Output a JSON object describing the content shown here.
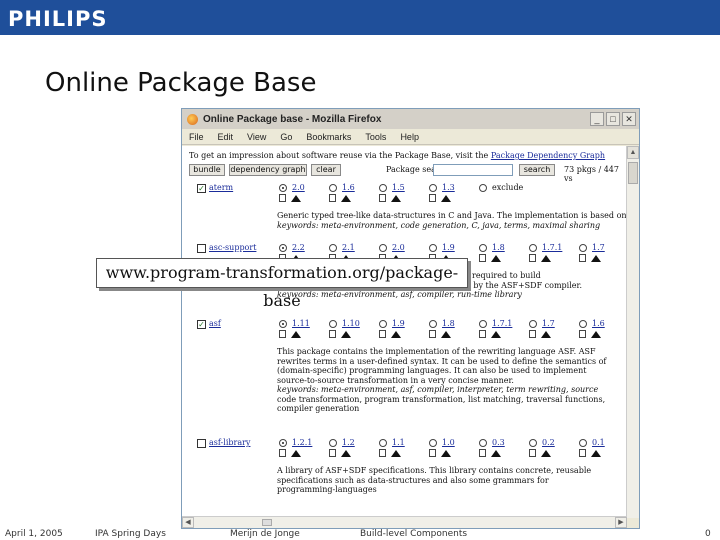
{
  "slide": {
    "logo": "PHILIPS",
    "title": "Online Package Base",
    "footer": {
      "date": "April 1, 2005",
      "event": "IPA Spring Days",
      "author": "Merijn de Jonge",
      "topic": "Build-level Components",
      "page": "0"
    },
    "callout": "www.program-transformation.org/package-base"
  },
  "colors": {
    "brand": "#1f4f9a",
    "link": "#1a2c9a"
  },
  "browser": {
    "title": "Online Package base - Mozilla Firefox",
    "window_buttons": [
      "_",
      "□",
      "✕"
    ],
    "menu": [
      "File",
      "Edit",
      "View",
      "Go",
      "Bookmarks",
      "Tools",
      "Help"
    ],
    "intro_text": "To get an impression about software reuse via the Package Base, visit the ",
    "intro_link": "Package Dependency Graph",
    "buttons": {
      "bundle": "bundle",
      "graph": "dependency graph",
      "clear": "clear",
      "search": "search"
    },
    "search_label": "Package search:",
    "page_info": "73 pkgs / 447 vs",
    "packages": [
      {
        "name": "aterm",
        "checked": true,
        "versions": [
          {
            "label": "2.0",
            "selected": true
          },
          {
            "label": "1.6",
            "selected": false
          },
          {
            "label": "1.5",
            "selected": false
          },
          {
            "label": "1.3",
            "selected": false
          }
        ],
        "exclude": "exclude",
        "desc": [
          "Generic typed tree-like data-structures in C and Java. The implementation is based on the ATerm",
          "keywords: meta-environment, code generation, C, java, terms, maximal sharing"
        ]
      },
      {
        "name": "asc-support",
        "checked": false,
        "versions": [
          {
            "label": "2.2",
            "selected": true
          },
          {
            "label": "2.1",
            "selected": false
          },
          {
            "label": "2.0",
            "selected": false
          },
          {
            "label": "1.9",
            "selected": false
          },
          {
            "label": "1.8",
            "selected": false
          },
          {
            "label": "1.7.1",
            "selected": false
          },
          {
            "label": "1.7",
            "selected": false
          }
        ],
        "desc": [
          "",
          "required to build",
          "stand-alone executables from C code generated by the ASF+SDF compiler.",
          "keywords: meta-environment, asf, compiler, run-time library"
        ]
      },
      {
        "name": "asf",
        "checked": true,
        "versions": [
          {
            "label": "1.11",
            "selected": true
          },
          {
            "label": "1.10",
            "selected": false
          },
          {
            "label": "1.9",
            "selected": false
          },
          {
            "label": "1.8",
            "selected": false
          },
          {
            "label": "1.7.1",
            "selected": false
          },
          {
            "label": "1.7",
            "selected": false
          },
          {
            "label": "1.6",
            "selected": false
          }
        ],
        "desc": [
          "This package contains the implementation of the rewriting language ASF. ASF",
          "rewrites terms in a user-defined syntax. It can be used to define the semantics of",
          "(domain-specific) programming languages. It can also be used to implement",
          "source-to-source transformation in a very concise manner.",
          "keywords: meta-environment, asf, compiler, interpreter, term rewriting, source",
          "code transformation, program transformation, list matching, traversal functions,",
          "compiler generation"
        ]
      },
      {
        "name": "asf-library",
        "checked": false,
        "versions": [
          {
            "label": "1.2.1",
            "selected": true
          },
          {
            "label": "1.2",
            "selected": false
          },
          {
            "label": "1.1",
            "selected": false
          },
          {
            "label": "1.0",
            "selected": false
          },
          {
            "label": "0.3",
            "selected": false
          },
          {
            "label": "0.2",
            "selected": false
          },
          {
            "label": "0.1",
            "selected": false
          }
        ],
        "desc": [
          "A library of ASF+SDF specifications. This library contains concrete, reusable",
          "specifications such as data-structures and also some grammars for",
          "programming-languages"
        ]
      }
    ]
  }
}
